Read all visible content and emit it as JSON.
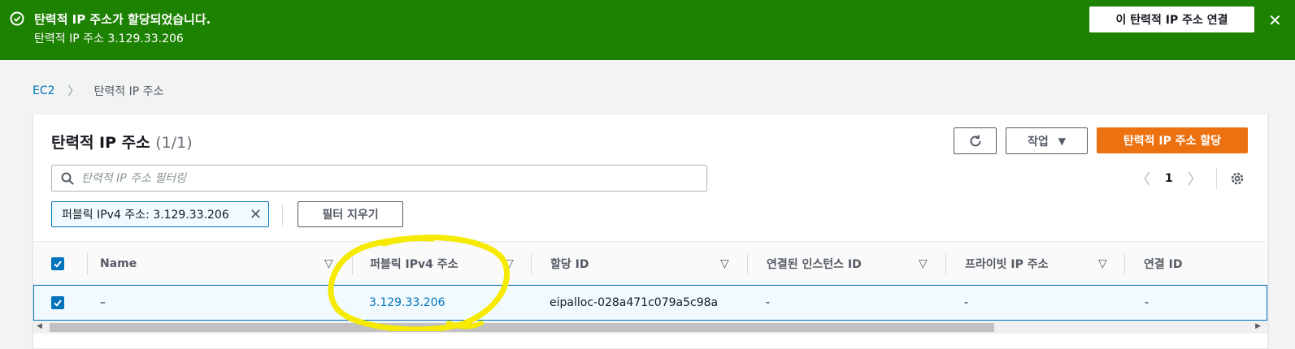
{
  "banner": {
    "title": "탄력적 IP 주소가 할당되었습니다.",
    "subtitle": "탄력적 IP 주소 3.129.33.206",
    "associate_label": "이 탄력적 IP 주소 연결",
    "color": "#1d8102"
  },
  "breadcrumb": {
    "root": "EC2",
    "current": "탄력적 IP 주소"
  },
  "panel": {
    "title": "탄력적 IP 주소",
    "count": "(1/1)",
    "actions_label": "작업",
    "allocate_label": "탄력적 IP 주소 할당",
    "search_placeholder": "탄력적 IP 주소 필터링",
    "page_number": "1",
    "filter_token": "퍼블릭 IPv4 주소: 3.129.33.206",
    "clear_filters_label": "필터 지우기"
  },
  "table": {
    "columns": [
      "Name",
      "퍼블릭 IPv4 주소",
      "할당 ID",
      "연결된 인스턴스 ID",
      "프라이빗 IP 주소",
      "연결 ID"
    ],
    "rows": [
      {
        "name": "–",
        "public_ip": "3.129.33.206",
        "allocation_id": "eipalloc-028a471c079a5c98a",
        "instance_id": "-",
        "private_ip": "-",
        "association_id": "-",
        "selected": true
      }
    ]
  },
  "colors": {
    "accent": "#0073bb",
    "primary_button": "#ec7211",
    "highlight": "#f5ea00"
  }
}
